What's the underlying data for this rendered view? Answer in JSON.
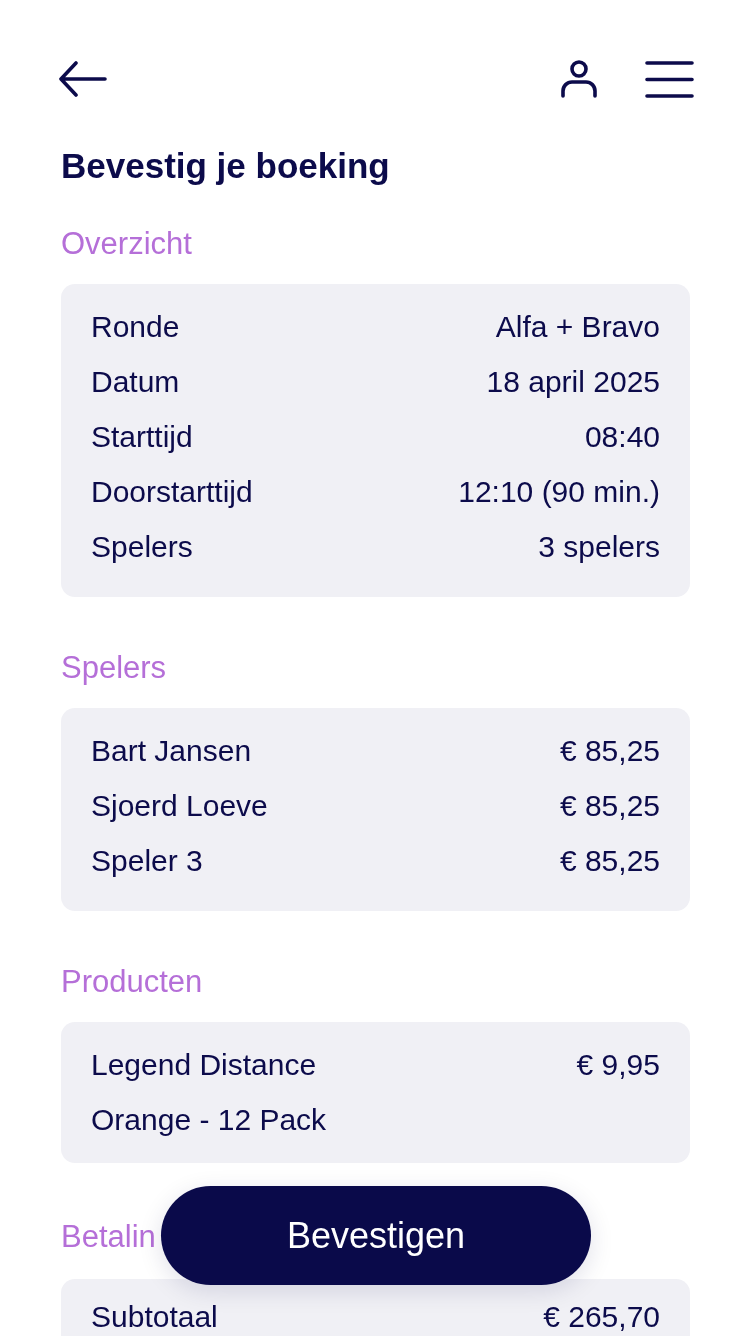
{
  "title": "Bevestig je boeking",
  "sections": [
    {
      "heading": "Overzicht",
      "rows": [
        {
          "label": "Ronde",
          "value": "Alfa + Bravo"
        },
        {
          "label": "Datum",
          "value": "18 april 2025"
        },
        {
          "label": "Starttijd",
          "value": "08:40"
        },
        {
          "label": "Doorstarttijd",
          "value": "12:10 (90 min.)"
        },
        {
          "label": "Spelers",
          "value": "3 spelers"
        }
      ]
    },
    {
      "heading": "Spelers",
      "rows": [
        {
          "label": "Bart Jansen",
          "value": "€ 85,25"
        },
        {
          "label": "Sjoerd Loeve",
          "value": "€ 85,25"
        },
        {
          "label": "Speler 3",
          "value": "€ 85,25"
        }
      ]
    },
    {
      "heading": "Producten",
      "rows": [
        {
          "label": "Legend Distance",
          "value": "€ 9,95"
        },
        {
          "label": "Orange - 12 Pack"
        }
      ]
    },
    {
      "heading": "Betalin",
      "rows": [
        {
          "label": "Subtotaal",
          "value": "€ 265,70"
        }
      ]
    }
  ],
  "confirm_button": {
    "label": "Bevestigen"
  }
}
